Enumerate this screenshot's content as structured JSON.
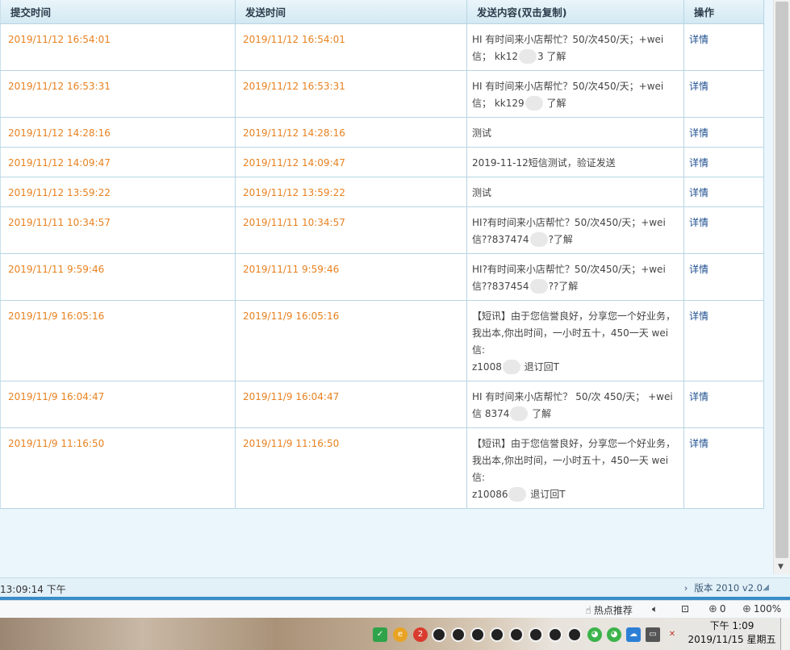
{
  "table": {
    "headers": [
      "提交时间",
      "发送时间",
      "发送内容(双击复制)",
      "操作"
    ],
    "rows": [
      {
        "submit": "2019/11/12 16:54:01",
        "send": "2019/11/12 16:54:01",
        "msg1": "HI 有时间来小店帮忙？50/次450/天；+wei",
        "msg2": "信； kk12",
        "msg2b": "3 了解",
        "msg3": "",
        "op": "详情"
      },
      {
        "submit": "2019/11/12 16:53:31",
        "send": "2019/11/12 16:53:31",
        "msg1": "HI 有时间来小店帮忙？50/次450/天；+wei",
        "msg2": "信； kk129",
        "msg2b": " 了解",
        "msg3": "",
        "op": "详情"
      },
      {
        "submit": "2019/11/12 14:28:16",
        "send": "2019/11/12 14:28:16",
        "msg1": "测试",
        "msg2": "",
        "msg2b": "",
        "msg3": "",
        "op": "详情"
      },
      {
        "submit": "2019/11/12 14:09:47",
        "send": "2019/11/12 14:09:47",
        "msg1": "2019-11-12短信测试，验证发送",
        "msg2": "",
        "msg2b": "",
        "msg3": "",
        "op": "详情"
      },
      {
        "submit": "2019/11/12 13:59:22",
        "send": "2019/11/12 13:59:22",
        "msg1": "测试",
        "msg2": "",
        "msg2b": "",
        "msg3": "",
        "op": "详情"
      },
      {
        "submit": "2019/11/11 10:34:57",
        "send": "2019/11/11 10:34:57",
        "msg1": "HI?有时间来小店帮忙？50/次450/天；+wei",
        "msg2": "信??837474",
        "msg2b": "?了解",
        "msg3": "",
        "op": "详情"
      },
      {
        "submit": "2019/11/11 9:59:46",
        "send": "2019/11/11 9:59:46",
        "msg1": "HI?有时间来小店帮忙？50/次450/天；+wei",
        "msg2": "信??837454",
        "msg2b": "??了解",
        "msg3": "",
        "op": "详情"
      },
      {
        "submit": "2019/11/9 16:05:16",
        "send": "2019/11/9 16:05:16",
        "msg1": "【短讯】由于您信誉良好，分享您一个好业务，",
        "msg2": "我出本,你出时间，一小时五十，450一天 wei信:",
        "msg2b": "",
        "msg3": "z1008",
        "msg3b": " 退订回T",
        "op": "详情"
      },
      {
        "submit": "2019/11/9 16:04:47",
        "send": "2019/11/9 16:04:47",
        "msg1": "HI 有时间来小店帮忙？ 50/次 450/天； +wei",
        "msg2": "信 8374",
        "msg2b": " 了解",
        "msg3": "",
        "op": "详情"
      },
      {
        "submit": "2019/11/9 11:16:50",
        "send": "2019/11/9 11:16:50",
        "msg1": "【短讯】由于您信誉良好，分享您一个好业务，",
        "msg2": "我出本,你出时间，一小时五十，450一天 wei信:",
        "msg2b": "",
        "msg3": "z10086",
        "msg3b": " 退订回T",
        "op": "详情"
      }
    ]
  },
  "status": {
    "time": "13:09:14 下午",
    "version": "版本 2010 v2.0"
  },
  "browser": {
    "hot": "热点推荐",
    "badge_count": "0",
    "zoom": "100%"
  },
  "taskbar": {
    "time": "下午 1:09",
    "date": "2019/11/15 星期五"
  },
  "colors": {
    "accent_orange": "#e8811f",
    "header_bg": "#d3e9f3",
    "link_blue": "#1d4e8f"
  }
}
